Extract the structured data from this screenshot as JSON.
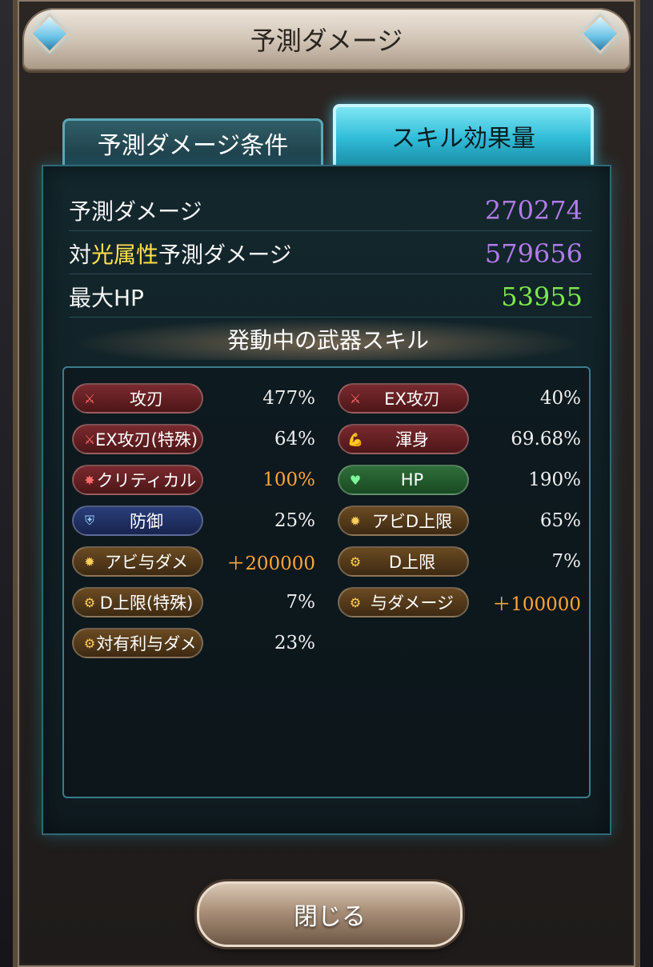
{
  "title": "予測ダメージ",
  "tabs": [
    {
      "label": "予測ダメージ条件",
      "active": false
    },
    {
      "label": "スキル効果量",
      "active": true
    }
  ],
  "stats": [
    {
      "label_parts": [
        "予測ダメージ"
      ],
      "value": "270274"
    },
    {
      "label_parts": [
        "対",
        "光属性",
        "予測ダメージ"
      ],
      "value": "579656"
    },
    {
      "label_parts": [
        "最大HP"
      ],
      "value": "53955"
    }
  ],
  "section_title": "発動中の武器スキル",
  "skills": [
    {
      "name": "攻刃",
      "value": "477%",
      "color": "red",
      "icon": "sword-icon"
    },
    {
      "name": "EX攻刃",
      "value": "40%",
      "color": "red",
      "icon": "sword-icon"
    },
    {
      "name": "EX攻刃(特殊)",
      "value": "64%",
      "color": "red",
      "icon": "sword-icon"
    },
    {
      "name": "渾身",
      "value": "69.68%",
      "color": "red",
      "icon": "arm-icon"
    },
    {
      "name": "クリティカル",
      "value": "100%",
      "color": "red",
      "icon": "burst-icon",
      "value_color": "#ffa436"
    },
    {
      "name": "HP",
      "value": "190%",
      "color": "green",
      "icon": "heart-icon"
    },
    {
      "name": "防御",
      "value": "25%",
      "color": "blue",
      "icon": "shield-icon"
    },
    {
      "name": "アビD上限",
      "value": "65%",
      "color": "gold",
      "icon": "ability-icon"
    },
    {
      "name": "アビ与ダメ",
      "value": "＋200000",
      "color": "gold",
      "icon": "ability-icon",
      "value_color": "#ffa436"
    },
    {
      "name": "D上限",
      "value": "7%",
      "color": "gold",
      "icon": "gear-icon"
    },
    {
      "name": "D上限(特殊)",
      "value": "7%",
      "color": "gold",
      "icon": "gear-icon"
    },
    {
      "name": "与ダメージ",
      "value": "＋100000",
      "color": "gold",
      "icon": "gear-icon",
      "value_color": "#ffa436"
    },
    {
      "name": "対有利与ダメ",
      "value": "23%",
      "color": "gold",
      "icon": "gear-icon"
    }
  ],
  "close_label": "閉じる"
}
